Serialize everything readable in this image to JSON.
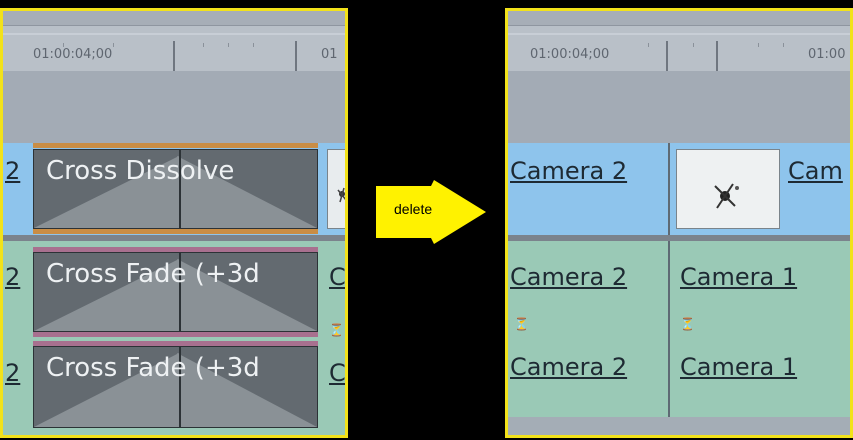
{
  "before": {
    "timecodes": [
      "01:00:04;00",
      "01"
    ],
    "track_prefix": [
      "2",
      "2",
      "2"
    ],
    "transitions": [
      "Cross Dissolve",
      "Cross Fade (+3d",
      "Cross Fade (+3d"
    ],
    "trailing_fragment": [
      "C",
      "C"
    ]
  },
  "action": {
    "label": "delete"
  },
  "after": {
    "timecodes": [
      "01:00:04;00",
      "01:00"
    ],
    "video_clips": [
      "Camera 2",
      "Cam"
    ],
    "audio_track_1": [
      "Camera 2",
      "Camera 1"
    ],
    "audio_track_2": [
      "Camera 2",
      "Camera 1"
    ]
  },
  "colors": {
    "highlight_border": "#f2e21a",
    "arrow_fill": "#fff200",
    "video_track": "#8ec4ec",
    "audio_track": "#9ac9b6"
  },
  "icons": [
    "thumbnail-image-icon",
    "keyframe-marker-icon",
    "arrow-right-icon"
  ]
}
